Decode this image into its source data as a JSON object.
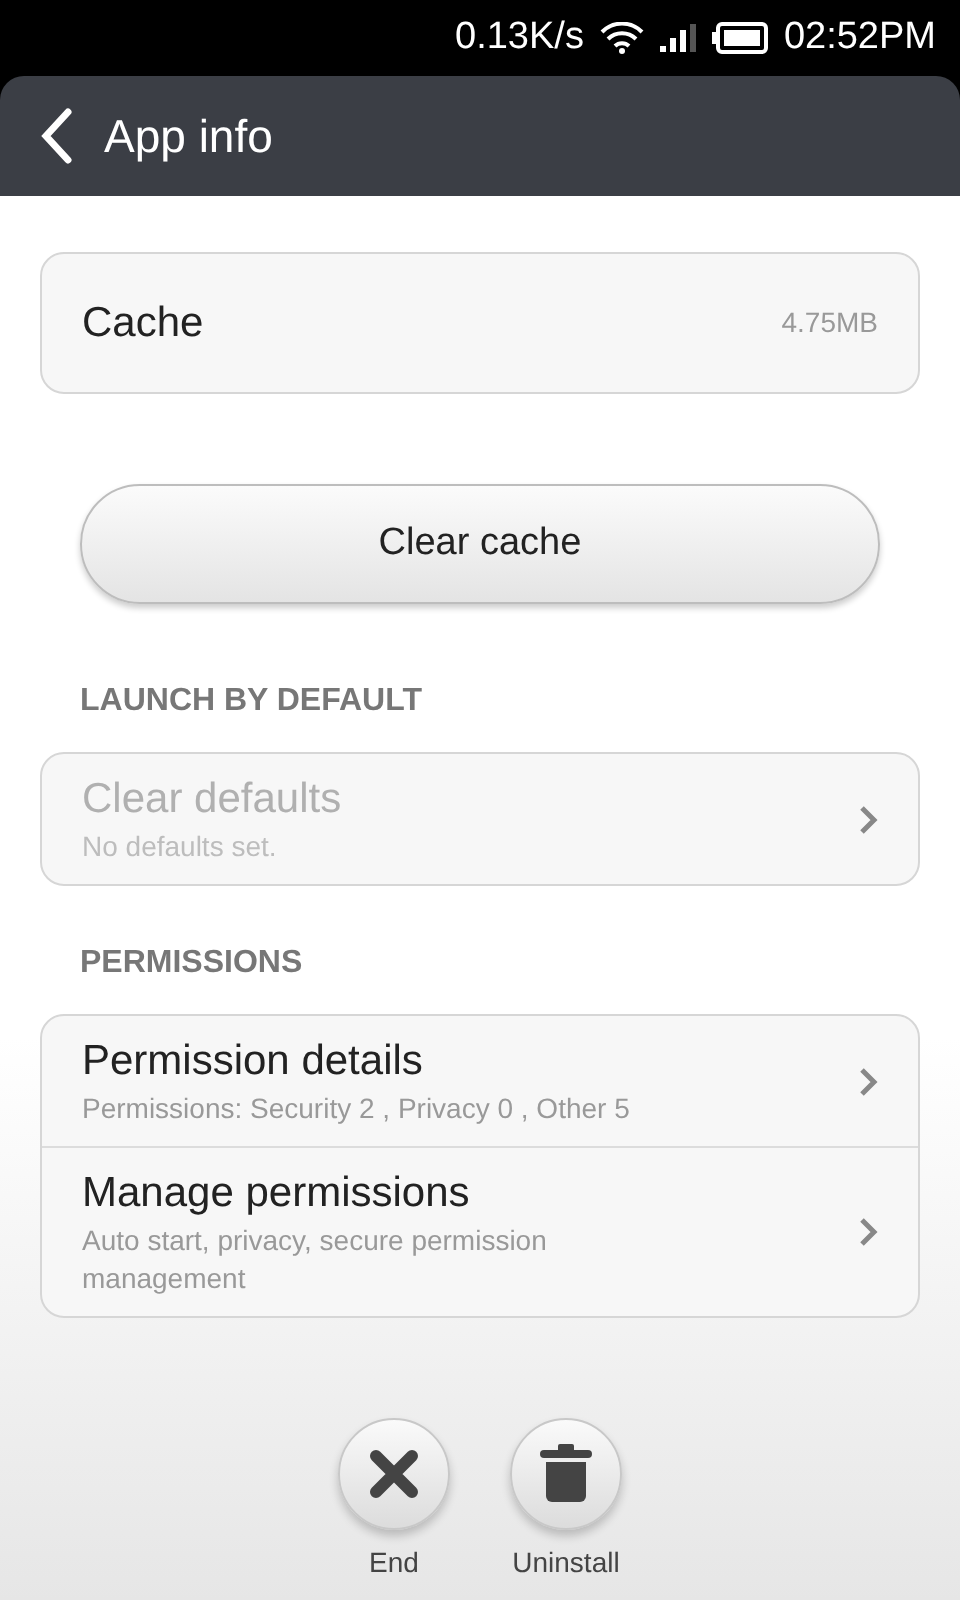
{
  "status_bar": {
    "speed": "0.13K/s",
    "time": "02:52PM"
  },
  "app_bar": {
    "title": "App info"
  },
  "cache_section": {
    "row": {
      "label": "Cache",
      "value": "4.75MB"
    },
    "button": "Clear cache"
  },
  "launch_section": {
    "header": "LAUNCH BY DEFAULT",
    "items": [
      {
        "title": "Clear defaults",
        "subtitle": "No defaults set.",
        "disabled": true
      }
    ]
  },
  "permissions_section": {
    "header": "PERMISSIONS",
    "items": [
      {
        "title": "Permission details",
        "subtitle": "Permissions: Security 2 , Privacy 0 , Other 5",
        "disabled": false
      },
      {
        "title": "Manage permissions",
        "subtitle": "Auto start, privacy, secure permission management",
        "disabled": false
      }
    ]
  },
  "actions": [
    {
      "kind": "end",
      "label": "End"
    },
    {
      "kind": "uninstall",
      "label": "Uninstall"
    }
  ]
}
